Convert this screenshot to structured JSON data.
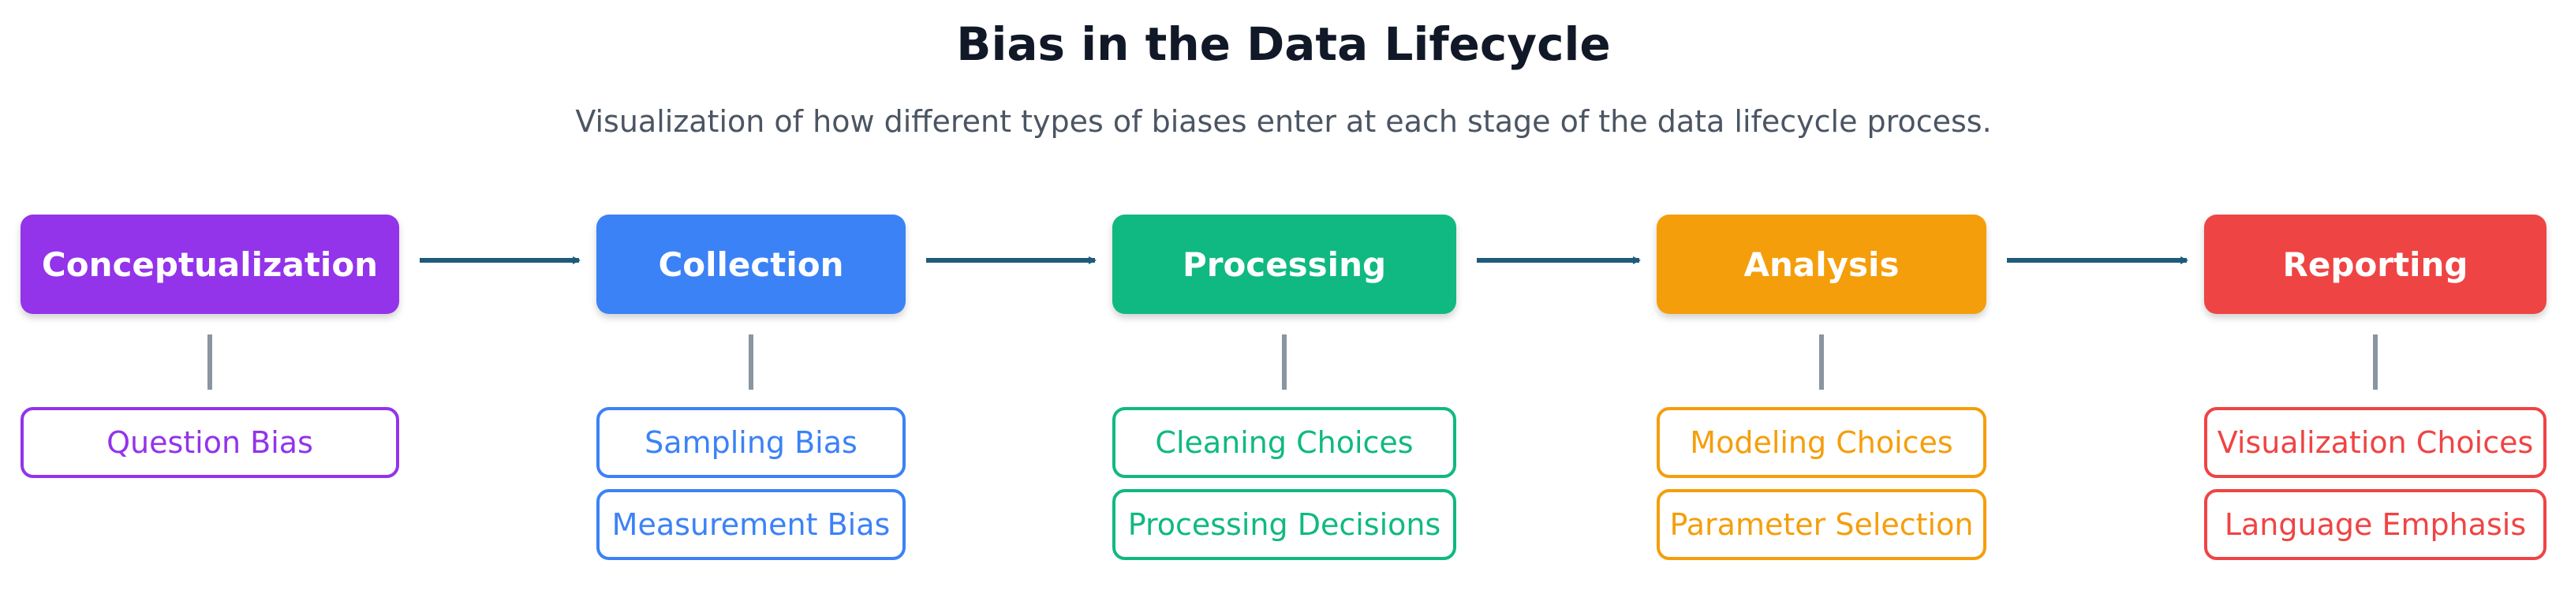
{
  "title": "Bias in the Data Lifecycle",
  "subtitle": "Visualization of how different types of biases enter at each stage of the data lifecycle process.",
  "colors": {
    "arrow": "#1e5b7a",
    "connector": "#8b95a1"
  },
  "stages": [
    {
      "label": "Conceptualization",
      "color": "#9333ea",
      "biases": [
        "Question Bias"
      ]
    },
    {
      "label": "Collection",
      "color": "#3b82f6",
      "biases": [
        "Sampling Bias",
        "Measurement Bias"
      ]
    },
    {
      "label": "Processing",
      "color": "#10b981",
      "biases": [
        "Cleaning Choices",
        "Processing Decisions"
      ]
    },
    {
      "label": "Analysis",
      "color": "#f59e0b",
      "biases": [
        "Modeling Choices",
        "Parameter Selection"
      ]
    },
    {
      "label": "Reporting",
      "color": "#ef4444",
      "biases": [
        "Visualization Choices",
        "Language Emphasis"
      ]
    }
  ]
}
